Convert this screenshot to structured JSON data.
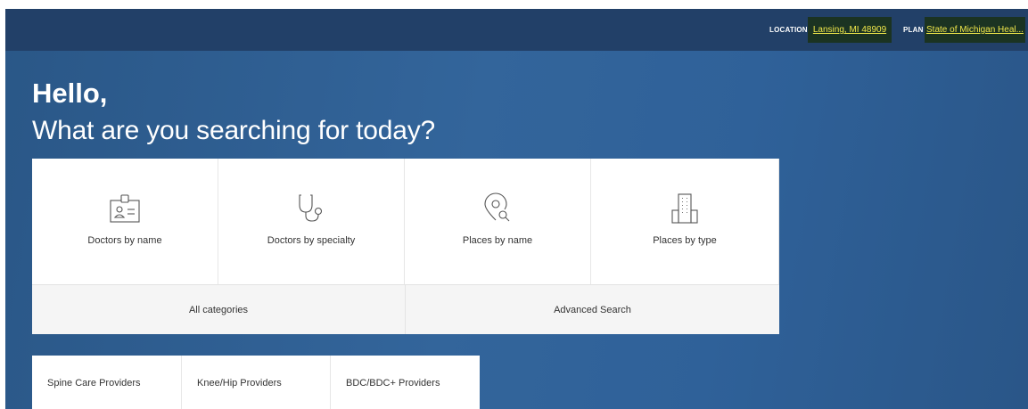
{
  "topbar": {
    "location_label": "LOCATION",
    "location_value": "Lansing, MI 48909",
    "plan_label": "PLAN",
    "plan_value": "State of Michigan Heal..."
  },
  "greeting": {
    "hello": "Hello,",
    "subtitle": "What are you searching for today?"
  },
  "search_tiles": [
    {
      "label": "Doctors by name",
      "icon": "id-badge-icon"
    },
    {
      "label": "Doctors by specialty",
      "icon": "stethoscope-icon"
    },
    {
      "label": "Places by name",
      "icon": "location-search-icon"
    },
    {
      "label": "Places by type",
      "icon": "building-icon"
    }
  ],
  "bottom_actions": {
    "all_categories": "All categories",
    "advanced_search": "Advanced Search"
  },
  "provider_tabs": [
    {
      "label": "Spine Care Providers"
    },
    {
      "label": "Knee/Hip Providers"
    },
    {
      "label": "BDC/BDC+ Providers"
    }
  ],
  "colors": {
    "header": "#224068",
    "background": "#33659b",
    "pill_bg": "#1b3322",
    "pill_text": "#f1e84a"
  }
}
